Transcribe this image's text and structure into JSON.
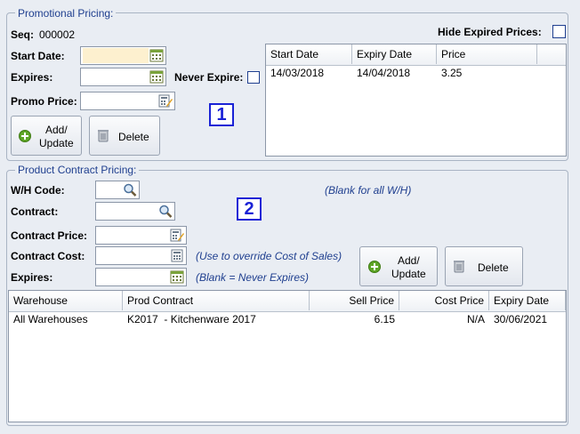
{
  "promo": {
    "legend": "Promotional Pricing:",
    "seq_label": "Seq:",
    "seq_value": "000002",
    "start_label": "Start Date:",
    "start_value": "",
    "expires_label": "Expires:",
    "expires_value": "",
    "never_expire_label": "Never Expire:",
    "price_label": "Promo Price:",
    "price_value": "",
    "hide_expired_label": "Hide Expired Prices:",
    "add_label_1": "Add/",
    "add_label_2": "Update",
    "delete_label": "Delete",
    "marker": "1",
    "table": {
      "headers": [
        "Start Date",
        "Expiry Date",
        "Price"
      ],
      "rows": [
        [
          "14/03/2018",
          "14/04/2018",
          "3.25"
        ]
      ]
    }
  },
  "contract": {
    "legend": "Product Contract Pricing:",
    "wh_label": "W/H Code:",
    "wh_value": "",
    "wh_note": "(Blank for all W/H)",
    "contract_label": "Contract:",
    "contract_value": "",
    "price_label": "Contract Price:",
    "price_value": "",
    "cost_label": "Contract Cost:",
    "cost_value": "",
    "cost_note": "(Use to override Cost of Sales)",
    "expires_label": "Expires:",
    "expires_value": "",
    "expires_note": "(Blank = Never Expires)",
    "add_label_1": "Add/",
    "add_label_2": "Update",
    "delete_label": "Delete",
    "marker": "2",
    "table": {
      "headers": [
        "Warehouse",
        "Prod Contract",
        "Sell Price",
        "Cost Price",
        "Expiry Date"
      ],
      "rows": [
        [
          "All Warehouses",
          "K2017  - Kitchenware 2017",
          "6.15",
          "N/A",
          "30/06/2021"
        ]
      ]
    }
  }
}
